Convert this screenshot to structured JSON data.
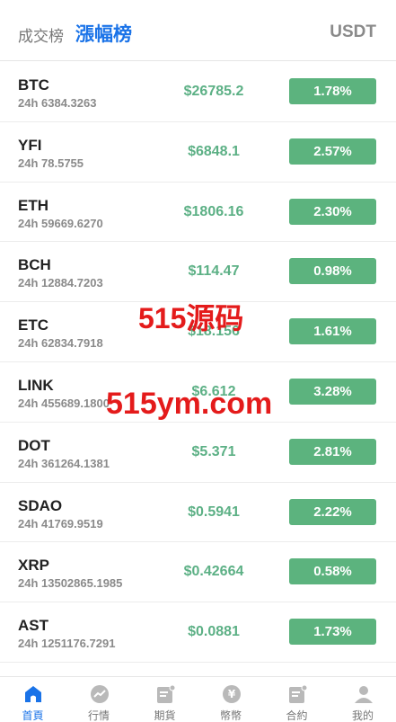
{
  "header": {
    "tab_volume": "成交榜",
    "tab_gain": "漲幅榜",
    "unit": "USDT"
  },
  "rows": [
    {
      "symbol": "BTC",
      "volume": "24h 6384.3263",
      "price": "$26785.2",
      "change": "1.78%"
    },
    {
      "symbol": "YFI",
      "volume": "24h 78.5755",
      "price": "$6848.1",
      "change": "2.57%"
    },
    {
      "symbol": "ETH",
      "volume": "24h 59669.6270",
      "price": "$1806.16",
      "change": "2.30%"
    },
    {
      "symbol": "BCH",
      "volume": "24h 12884.7203",
      "price": "$114.47",
      "change": "0.98%"
    },
    {
      "symbol": "ETC",
      "volume": "24h 62834.7918",
      "price": "$18.156",
      "change": "1.61%"
    },
    {
      "symbol": "LINK",
      "volume": "24h 455689.1800",
      "price": "$6.612",
      "change": "3.28%"
    },
    {
      "symbol": "DOT",
      "volume": "24h 361264.1381",
      "price": "$5.371",
      "change": "2.81%"
    },
    {
      "symbol": "SDAO",
      "volume": "24h 41769.9519",
      "price": "$0.5941",
      "change": "2.22%"
    },
    {
      "symbol": "XRP",
      "volume": "24h 13502865.1985",
      "price": "$0.42664",
      "change": "0.58%"
    },
    {
      "symbol": "AST",
      "volume": "24h 1251176.7291",
      "price": "$0.0881",
      "change": "1.73%"
    }
  ],
  "watermark": {
    "line1": "515源码",
    "line2": "515ym.com"
  },
  "tabbar": [
    {
      "label": "首頁",
      "icon": "home-icon",
      "active": true
    },
    {
      "label": "行情",
      "icon": "trend-icon",
      "active": false
    },
    {
      "label": "期貨",
      "icon": "futures-icon",
      "active": false
    },
    {
      "label": "幣幣",
      "icon": "coin-icon",
      "active": false
    },
    {
      "label": "合約",
      "icon": "contract-icon",
      "active": false
    },
    {
      "label": "我的",
      "icon": "user-icon",
      "active": false
    }
  ],
  "colors": {
    "accent": "#1a73e8",
    "up": "#5cb37e",
    "watermark": "#e41b1b"
  }
}
